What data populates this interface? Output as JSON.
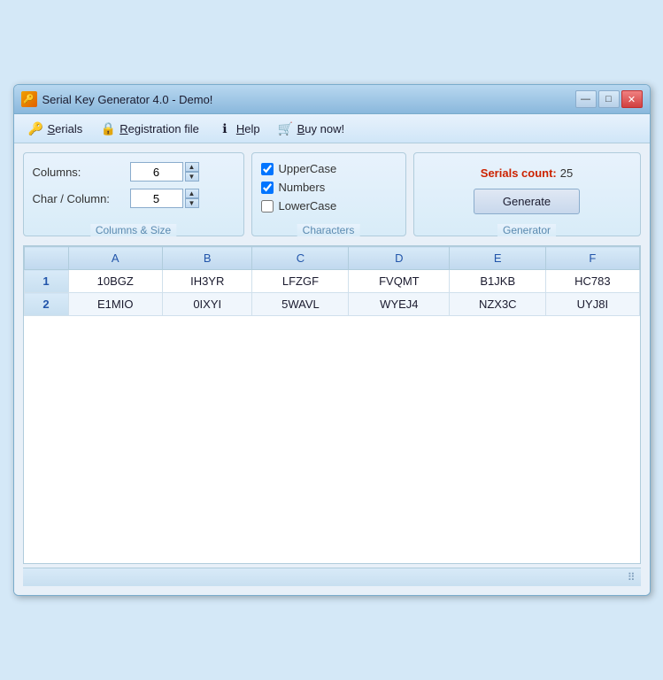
{
  "window": {
    "title": "Serial Key Generator 4.0 - Demo!",
    "title_icon": "🔑"
  },
  "menu": {
    "items": [
      {
        "id": "serials",
        "icon": "🔑",
        "label": "Serials",
        "underline": "S"
      },
      {
        "id": "registration-file",
        "icon": "🔒",
        "label": "Registration file",
        "underline": "R"
      },
      {
        "id": "help",
        "icon": "ℹ",
        "label": "Help",
        "underline": "H"
      },
      {
        "id": "buy-now",
        "icon": "🛒",
        "label": "Buy now!",
        "underline": "B"
      }
    ]
  },
  "panels": {
    "columns_size": {
      "title": "Columns & Size",
      "columns_label": "Columns:",
      "columns_value": "6",
      "char_column_label": "Char / Column:",
      "char_column_value": "5"
    },
    "characters": {
      "title": "Characters",
      "uppercase_label": "UpperCase",
      "uppercase_checked": true,
      "numbers_label": "Numbers",
      "numbers_checked": true,
      "lowercase_label": "LowerCase",
      "lowercase_checked": false
    },
    "generator": {
      "title": "Generator",
      "serials_count_label": "Serials count:",
      "serials_count_value": "25",
      "generate_label": "Generate"
    }
  },
  "table": {
    "header_row_label": "",
    "columns": [
      "",
      "A",
      "B",
      "C",
      "D",
      "E",
      "F"
    ],
    "rows": [
      {
        "num": "1",
        "a": "10BGZ",
        "b": "IH3YR",
        "c": "LFZGF",
        "d": "FVQMT",
        "e": "B1JKB",
        "f": "HC783"
      },
      {
        "num": "2",
        "a": "E1MIO",
        "b": "0IXYI",
        "c": "5WAVL",
        "d": "WYEJ4",
        "e": "NZX3C",
        "f": "UYJ8I"
      }
    ]
  },
  "titlebar_buttons": {
    "minimize": "—",
    "maximize": "□",
    "close": "✕"
  }
}
